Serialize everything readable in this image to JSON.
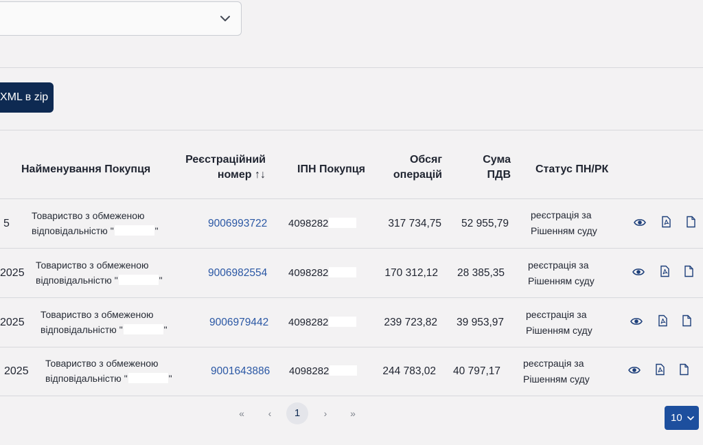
{
  "toolbar": {
    "export_label": "XML в zip"
  },
  "table": {
    "headers": {
      "buyer_name": "Найменування Покупця",
      "reg_number_line1": "Реєстраційний",
      "reg_number_line2": "номер",
      "sort_glyph": "↑↓",
      "buyer_ipn": "ІПН Покупця",
      "volume_line1": "Обсяг",
      "volume_line2": "операцій",
      "vat_line1": "Сума",
      "vat_line2": "ПДВ",
      "status": "Статус ПН/РК"
    },
    "rows": [
      {
        "date": "5",
        "name_line1": "Товариство з обмеженою",
        "name_line2_pre": "відповідальністю \"",
        "name_line2_post": "\"",
        "reg_number": "9006993722",
        "ipn": "4098282",
        "volume": "317 734,75",
        "vat": "52 955,79",
        "status_line1": "реєстрація за",
        "status_line2": "Рішенням суду"
      },
      {
        "date": "2025",
        "name_line1": "Товариство з обмеженою",
        "name_line2_pre": "відповідальністю \"",
        "name_line2_post": "\"",
        "reg_number": "9006982554",
        "ipn": "4098282",
        "volume": "170 312,12",
        "vat": "28 385,35",
        "status_line1": "реєстрація за",
        "status_line2": "Рішенням суду"
      },
      {
        "date": "2025",
        "name_line1": "Товариство з обмеженою",
        "name_line2_pre": "відповідальністю \"",
        "name_line2_post": "\"",
        "reg_number": "9006979442",
        "ipn": "4098282",
        "volume": "239 723,82",
        "vat": "39 953,97",
        "status_line1": "реєстрація за",
        "status_line2": "Рішенням суду"
      },
      {
        "date": "2025",
        "name_line1": "Товариство з обмеженою",
        "name_line2_pre": "відповідальністю \"",
        "name_line2_post": "\"",
        "reg_number": "9001643886",
        "ipn": "4098282",
        "volume": "244 783,02",
        "vat": "40 797,17",
        "status_line1": "реєстрація за",
        "status_line2": "Рішенням суду"
      }
    ]
  },
  "pagination": {
    "first": "«",
    "prev": "‹",
    "current": "1",
    "next": "›",
    "last": "»",
    "per_page": "10"
  },
  "colors": {
    "primary_dark": "#0e2a52",
    "link": "#2a57a4",
    "per_page_bg": "#1d4f9e"
  },
  "icons": [
    "chevron-down-icon",
    "eye-icon",
    "pdf-file-icon",
    "document-icon"
  ]
}
